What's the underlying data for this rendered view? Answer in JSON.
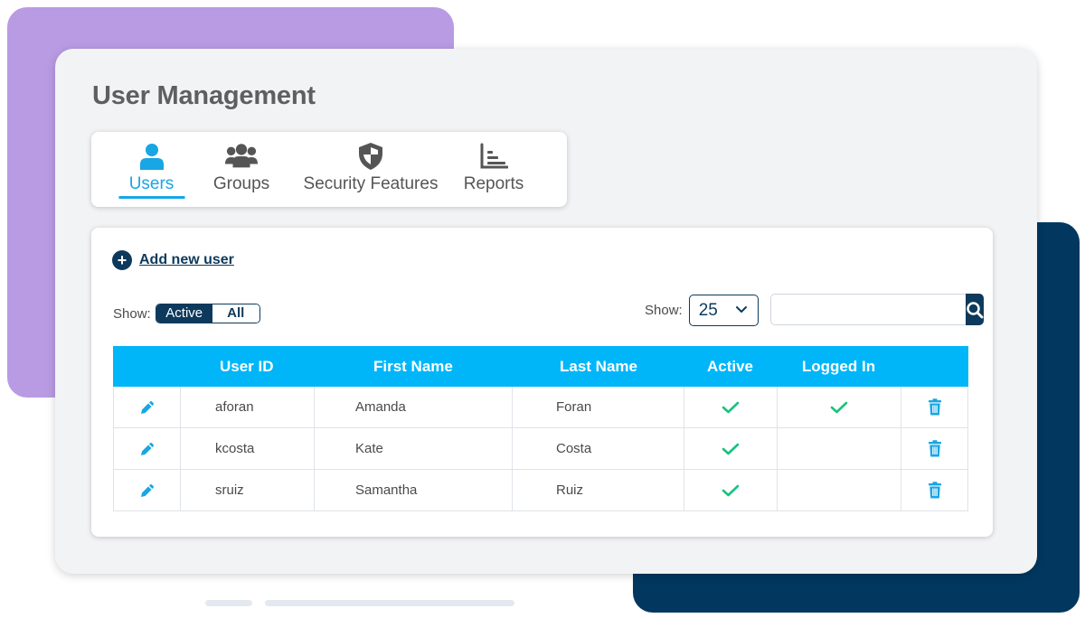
{
  "page_title": "User Management",
  "tabs": [
    {
      "label": "Users",
      "icon": "user-icon",
      "active": true
    },
    {
      "label": "Groups",
      "icon": "group-icon",
      "active": false
    },
    {
      "label": "Security Features",
      "icon": "shield-icon",
      "active": false
    },
    {
      "label": "Reports",
      "icon": "chart-icon",
      "active": false
    }
  ],
  "toolbar": {
    "add_user_label": "Add new user",
    "show_label": "Show:",
    "filter_options": [
      "Active",
      "All"
    ],
    "filter_selected": "Active",
    "page_size_label": "Show:",
    "page_size_value": "25",
    "search_placeholder": ""
  },
  "table": {
    "columns": [
      "",
      "User ID",
      "First Name",
      "Last Name",
      "Active",
      "Logged In",
      ""
    ],
    "rows": [
      {
        "user_id": "aforan",
        "first_name": "Amanda",
        "last_name": "Foran",
        "active": true,
        "logged_in": true
      },
      {
        "user_id": "kcosta",
        "first_name": "Kate",
        "last_name": "Costa",
        "active": true,
        "logged_in": false
      },
      {
        "user_id": "sruiz",
        "first_name": "Samantha",
        "last_name": "Ruiz",
        "active": true,
        "logged_in": false
      }
    ]
  },
  "colors": {
    "accent": "#18a6e4",
    "header_bg": "#00b6f9",
    "navy": "#0d3a5c",
    "check": "#19c37d",
    "decor_purple": "#b99be3",
    "decor_navy": "#02385f"
  }
}
